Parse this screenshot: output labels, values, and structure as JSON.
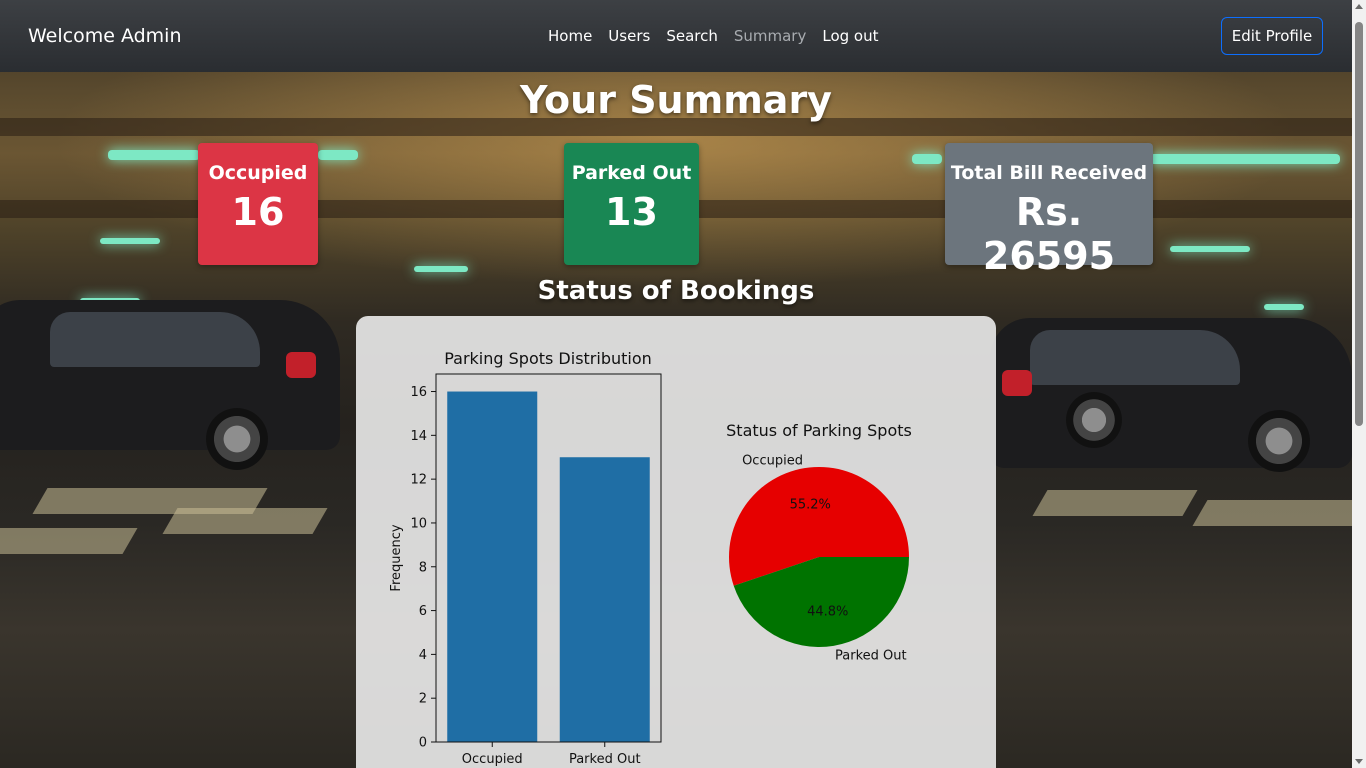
{
  "navbar": {
    "brand": "Welcome Admin",
    "links": [
      {
        "label": "Home",
        "active": false
      },
      {
        "label": "Users",
        "active": false
      },
      {
        "label": "Search",
        "active": false
      },
      {
        "label": "Summary",
        "active": true
      },
      {
        "label": "Log out",
        "active": false
      }
    ],
    "edit_profile_label": "Edit Profile"
  },
  "page": {
    "title": "Your Summary",
    "section_title": "Status of Bookings"
  },
  "cards": {
    "occupied": {
      "label": "Occupied",
      "value": "16",
      "color": "#dc3545"
    },
    "parked_out": {
      "label": "Parked Out",
      "value": "13",
      "color": "#198754"
    },
    "total_bill": {
      "label": "Total Bill Received",
      "value": "Rs. 26595",
      "color": "#6c757d"
    }
  },
  "chart_data": [
    {
      "type": "bar",
      "title": "Parking Spots Distribution",
      "categories": [
        "Occupied",
        "Parked Out"
      ],
      "values": [
        16,
        13
      ],
      "xlabel": "",
      "ylabel": "Frequency",
      "ylim": [
        0,
        16.8
      ],
      "yticks": [
        0,
        2,
        4,
        6,
        8,
        10,
        12,
        14,
        16
      ],
      "color": "#1f6ea5",
      "grid": false
    },
    {
      "type": "pie",
      "title": "Status of Parking Spots",
      "labels": [
        "Occupied",
        "Parked Out"
      ],
      "values": [
        16,
        13
      ],
      "percent_labels": [
        "55.2%",
        "44.8%"
      ],
      "colors": [
        "#e60000",
        "#007300"
      ]
    }
  ]
}
